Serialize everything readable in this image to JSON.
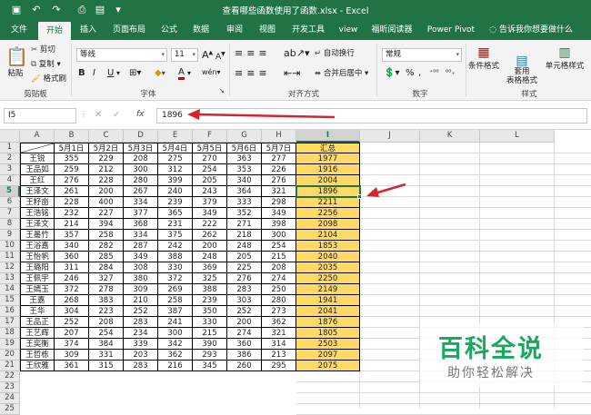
{
  "window": {
    "doc_title": "查看哪些函数使用了函数.xlsx - Excel"
  },
  "quick_access": [
    "save-icon",
    "undo-icon",
    "redo-icon",
    "print-preview-icon",
    "paste-icon",
    "customize-icon"
  ],
  "tabs": [
    "文件",
    "开始",
    "插入",
    "页面布局",
    "公式",
    "数据",
    "审阅",
    "视图",
    "开发工具",
    "view",
    "福昕阅读器",
    "Power Pivot",
    "告诉我你想要做什么"
  ],
  "active_tab": "开始",
  "ribbon": {
    "clipboard": {
      "paste": "粘贴",
      "cut": "剪切",
      "copy": "复制",
      "format_painter": "格式刷",
      "label": "剪贴板"
    },
    "font": {
      "name": "等线",
      "size": "11",
      "label": "字体",
      "bold": "B",
      "italic": "I",
      "underline": "U",
      "grow": "A",
      "shrink": "A",
      "font_color": "A",
      "phonetic": "wén"
    },
    "alignment": {
      "wrap": "自动换行",
      "merge": "合并后居中",
      "label": "对齐方式"
    },
    "number": {
      "format": "常规",
      "percent": "%",
      "comma": ",",
      "label": "数字"
    },
    "styles": {
      "conditional": "条件格式",
      "table": "套用\n表格格式",
      "cell_styles": "单元格样式",
      "label": "样式"
    }
  },
  "formula_bar": {
    "name_box": "I5",
    "fx": "fx",
    "value": "1896"
  },
  "sheet": {
    "columns": [
      "A",
      "B",
      "C",
      "D",
      "E",
      "F",
      "G",
      "H",
      "I",
      "J",
      "K",
      "L"
    ],
    "header_row": [
      "",
      "5月1日",
      "5月2日",
      "5月3日",
      "5月4日",
      "5月5日",
      "5月6日",
      "5月7日",
      "汇总"
    ],
    "rows": [
      [
        "王锐",
        "355",
        "229",
        "208",
        "275",
        "270",
        "363",
        "277",
        "1977"
      ],
      [
        "王品如",
        "259",
        "212",
        "300",
        "312",
        "254",
        "353",
        "226",
        "1916"
      ],
      [
        "王红",
        "276",
        "228",
        "280",
        "399",
        "205",
        "340",
        "276",
        "2004"
      ],
      [
        "王泽文",
        "261",
        "200",
        "267",
        "240",
        "243",
        "364",
        "321",
        "1896"
      ],
      [
        "王籽亩",
        "228",
        "400",
        "334",
        "239",
        "379",
        "333",
        "298",
        "2211"
      ],
      [
        "王浩铭",
        "232",
        "227",
        "377",
        "365",
        "349",
        "352",
        "349",
        "2256"
      ],
      [
        "王泽文",
        "214",
        "394",
        "368",
        "231",
        "222",
        "271",
        "398",
        "2098"
      ],
      [
        "王墨竹",
        "357",
        "258",
        "334",
        "375",
        "262",
        "218",
        "300",
        "2104"
      ],
      [
        "王浴嘉",
        "340",
        "282",
        "287",
        "242",
        "200",
        "248",
        "254",
        "1853"
      ],
      [
        "王怡帆",
        "360",
        "285",
        "349",
        "388",
        "248",
        "205",
        "215",
        "2040"
      ],
      [
        "王璐阳",
        "311",
        "284",
        "308",
        "330",
        "369",
        "225",
        "208",
        "2035"
      ],
      [
        "王佩宇",
        "246",
        "327",
        "380",
        "372",
        "325",
        "276",
        "274",
        "2250"
      ],
      [
        "王嫣玉",
        "372",
        "278",
        "309",
        "269",
        "388",
        "283",
        "250",
        "2149"
      ],
      [
        "王嘉",
        "268",
        "383",
        "210",
        "258",
        "239",
        "303",
        "280",
        "1941"
      ],
      [
        "王华",
        "304",
        "223",
        "252",
        "387",
        "350",
        "252",
        "273",
        "2041"
      ],
      [
        "王品正",
        "252",
        "208",
        "283",
        "241",
        "330",
        "200",
        "362",
        "1876"
      ],
      [
        "王艺辉",
        "207",
        "254",
        "234",
        "300",
        "215",
        "274",
        "321",
        "1805"
      ],
      [
        "王奕衡",
        "374",
        "384",
        "339",
        "342",
        "390",
        "360",
        "314",
        "2503"
      ],
      [
        "王哲栋",
        "309",
        "331",
        "203",
        "362",
        "293",
        "386",
        "213",
        "2097"
      ],
      [
        "王欣雅",
        "361",
        "315",
        "283",
        "216",
        "345",
        "260",
        "295",
        "2075"
      ]
    ]
  },
  "watermark": {
    "title": "百科全说",
    "subtitle": "助你轻松解决"
  },
  "colors": {
    "excel_green": "#217346",
    "sum_fill": "#ffd966",
    "arrow_red": "#d9232a",
    "watermark_green": "#1aa85e"
  }
}
